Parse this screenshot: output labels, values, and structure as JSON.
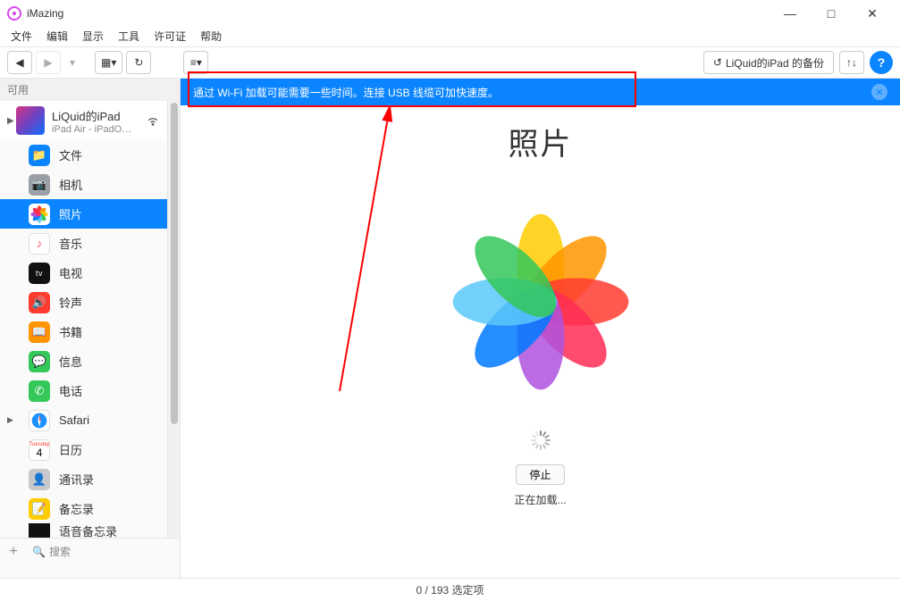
{
  "app": {
    "title": "iMazing"
  },
  "window": {
    "minimize": "—",
    "maximize": "□",
    "close": "✕"
  },
  "menu": [
    "文件",
    "编辑",
    "显示",
    "工具",
    "许可证",
    "帮助"
  ],
  "toolbar": {
    "back": "◀",
    "play": "▶",
    "more": "▾",
    "grid": "▦▾",
    "refresh": "↻",
    "list": "≡▾",
    "backup_label": "LiQuid的iPad  的备份",
    "sync": "↑↓",
    "help": "?"
  },
  "sidebar": {
    "section": "可用",
    "device": {
      "name": "LiQuid的iPad",
      "subtitle": "iPad Air - iPadO…",
      "wifi": "true"
    },
    "items": [
      {
        "label": "文件",
        "icon": "files"
      },
      {
        "label": "相机",
        "icon": "camera"
      },
      {
        "label": "照片",
        "icon": "photos",
        "selected": true
      },
      {
        "label": "音乐",
        "icon": "music"
      },
      {
        "label": "电视",
        "icon": "tv"
      },
      {
        "label": "铃声",
        "icon": "ring"
      },
      {
        "label": "书籍",
        "icon": "books"
      },
      {
        "label": "信息",
        "icon": "msg"
      },
      {
        "label": "电话",
        "icon": "phone"
      },
      {
        "label": "Safari",
        "icon": "safari",
        "caret": true
      },
      {
        "label": "日历",
        "icon": "cal"
      },
      {
        "label": "通讯录",
        "icon": "contacts"
      },
      {
        "label": "备忘录",
        "icon": "notes"
      },
      {
        "label": "语音备忘录",
        "icon": "voice",
        "cut": true
      }
    ],
    "add": "+",
    "search_placeholder": "搜索"
  },
  "banner": {
    "text": "通过 Wi-Fi 加载可能需要一些时间。连接 USB 线缆可加快速度。"
  },
  "main": {
    "title": "照片",
    "stop": "停止",
    "loading": "正在加载..."
  },
  "status": {
    "text": "0 / 193 选定项"
  }
}
